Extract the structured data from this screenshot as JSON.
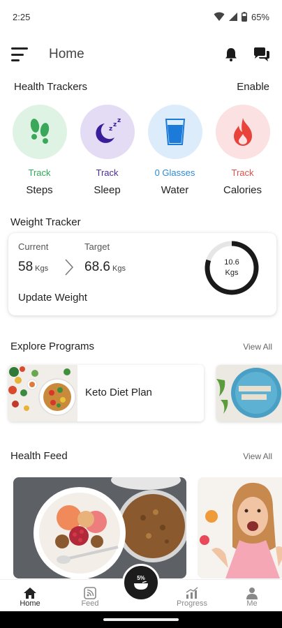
{
  "status_bar": {
    "time": "2:25",
    "battery": "65%"
  },
  "header": {
    "title": "Home"
  },
  "health_trackers": {
    "title": "Health Trackers",
    "action": "Enable",
    "items": [
      {
        "status": "Track",
        "label": "Steps",
        "status_color": "#2eaa55",
        "bg": "#dff3e4",
        "icon": "footprints-icon"
      },
      {
        "status": "Track",
        "label": "Sleep",
        "status_color": "#4a2a9a",
        "bg": "#e4dcf5",
        "icon": "moon-sleep-icon"
      },
      {
        "status": "0 Glasses",
        "label": "Water",
        "status_color": "#2b8ad8",
        "bg": "#dcecfb",
        "icon": "water-glass-icon"
      },
      {
        "status": "Track",
        "label": "Calories",
        "status_color": "#e0504a",
        "bg": "#fbe1e1",
        "icon": "flame-icon"
      }
    ]
  },
  "weight_tracker": {
    "title": "Weight Tracker",
    "current_label": "Current",
    "current_value": "58",
    "target_label": "Target",
    "target_value": "68.6",
    "unit": "Kgs",
    "remaining_value": "10.6",
    "remaining_unit": "Kgs",
    "progress_fraction": 0.8,
    "update_label": "Update Weight"
  },
  "programs": {
    "title": "Explore Programs",
    "view_all": "View All",
    "items": [
      {
        "label": "Keto Diet Plan"
      }
    ]
  },
  "health_feed": {
    "title": "Health Feed",
    "view_all": "View All"
  },
  "bottom_nav": {
    "items": [
      {
        "label": "Home",
        "icon": "home-icon",
        "active": true
      },
      {
        "label": "Feed",
        "icon": "feed-icon",
        "active": false
      },
      {
        "label": "Progress",
        "icon": "progress-icon",
        "active": false
      },
      {
        "label": "Me",
        "icon": "person-icon",
        "active": false
      }
    ],
    "fab_text": "5%"
  }
}
